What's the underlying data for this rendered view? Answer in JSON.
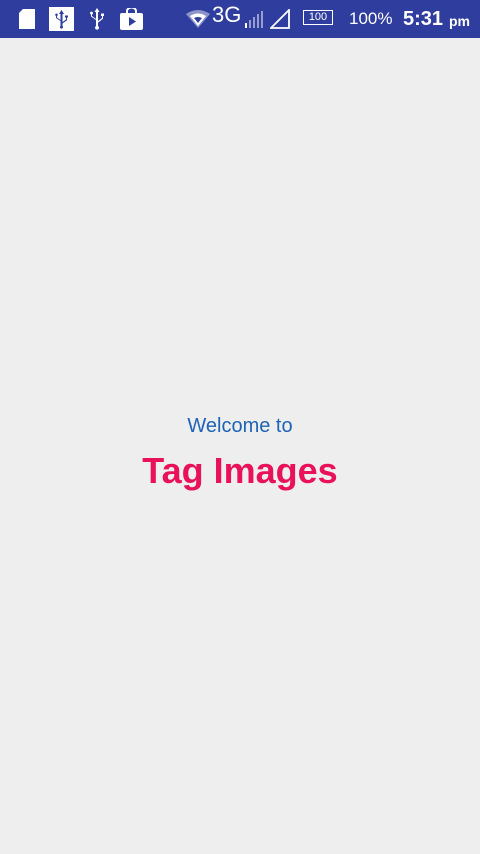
{
  "status_bar": {
    "network_type": "3G",
    "battery_level_box": "100",
    "battery_percent": "100%",
    "time": "5:31",
    "am_pm": "pm",
    "icons": [
      "sd-card-icon",
      "usb-debug-icon",
      "usb-icon",
      "play-store-icon",
      "wifi-icon",
      "signal-icon",
      "cell-signal-icon",
      "battery-icon"
    ],
    "background_color": "#2f3e9e"
  },
  "main": {
    "welcome_text": "Welcome to",
    "app_title": "Tag Images",
    "welcome_color": "#1e63b4",
    "title_color": "#e8115a",
    "background_color": "#eeeeee"
  }
}
